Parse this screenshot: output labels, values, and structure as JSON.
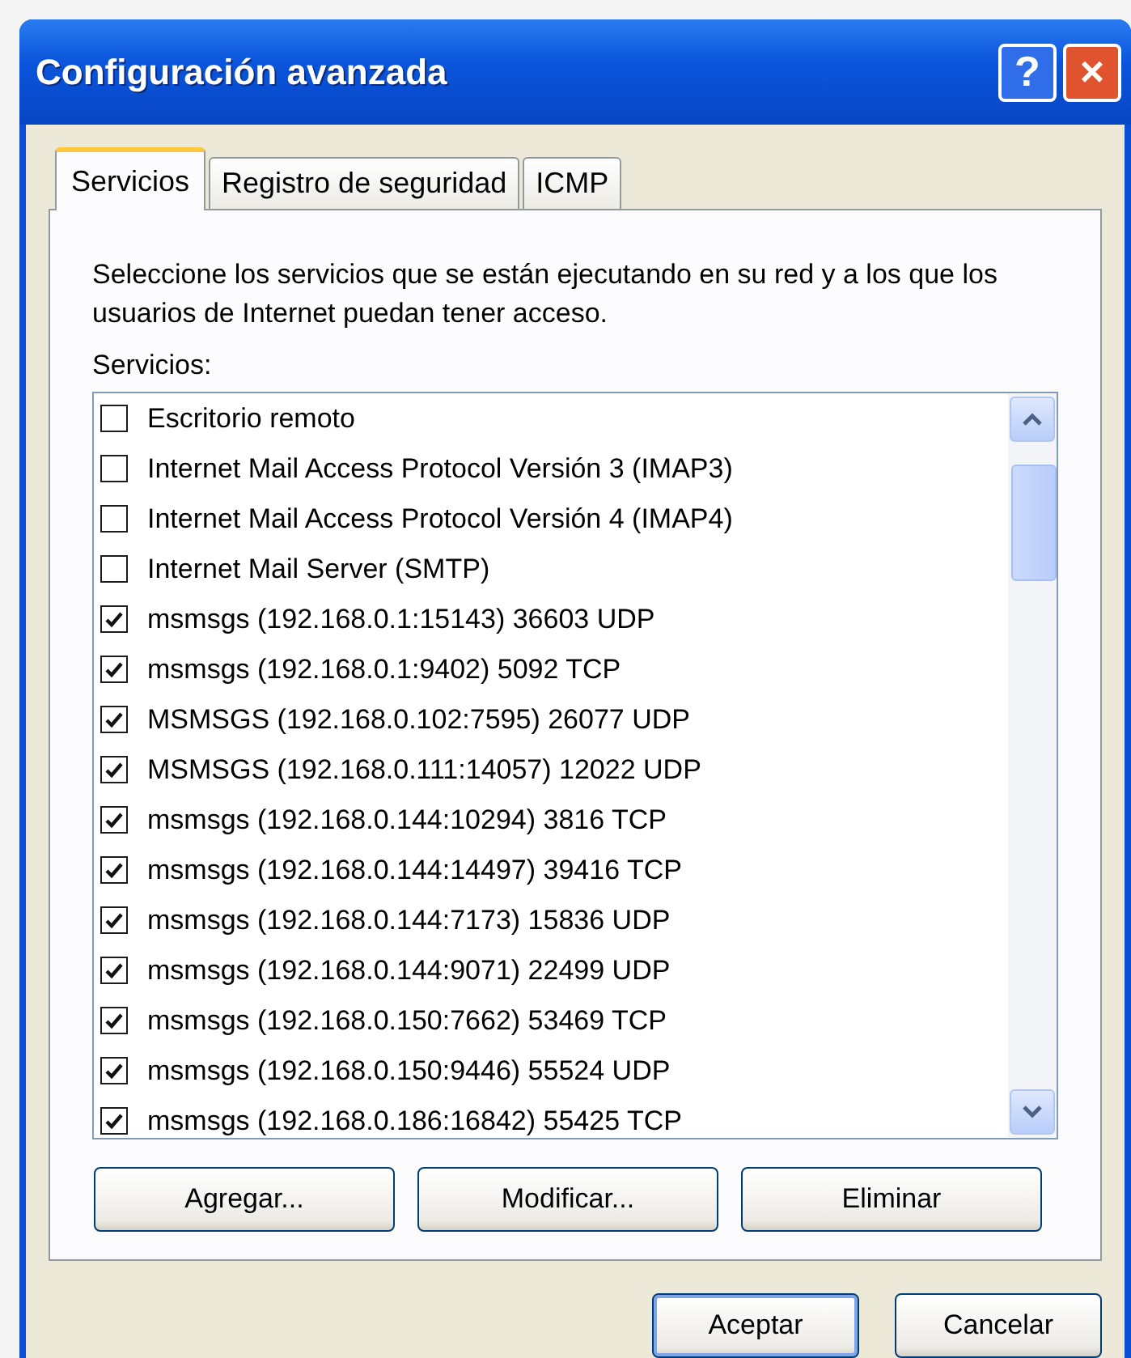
{
  "window": {
    "title": "Configuración avanzada",
    "title_buttons": [
      "?",
      "×"
    ]
  },
  "tabs": [
    {
      "label": "Servicios",
      "selected": true
    },
    {
      "label": "Registro de seguridad",
      "selected": false
    },
    {
      "label": "ICMP",
      "selected": false
    }
  ],
  "description": "Seleccione los servicios que se están ejecutando en su red y a los que los usuarios de Internet puedan tener acceso.",
  "services_label": "Servicios:",
  "services": [
    {
      "label": "Escritorio remoto",
      "checked": false
    },
    {
      "label": "Internet Mail Access Protocol Versión 3 (IMAP3)",
      "checked": false
    },
    {
      "label": "Internet Mail Access Protocol Versión 4 (IMAP4)",
      "checked": false
    },
    {
      "label": "Internet Mail Server (SMTP)",
      "checked": false
    },
    {
      "label": "msmsgs (192.168.0.1:15143) 36603 UDP",
      "checked": true
    },
    {
      "label": "msmsgs (192.168.0.1:9402) 5092 TCP",
      "checked": true
    },
    {
      "label": "MSMSGS (192.168.0.102:7595) 26077 UDP",
      "checked": true
    },
    {
      "label": "MSMSGS (192.168.0.111:14057) 12022 UDP",
      "checked": true
    },
    {
      "label": "msmsgs (192.168.0.144:10294) 3816 TCP",
      "checked": true
    },
    {
      "label": "msmsgs (192.168.0.144:14497) 39416 TCP",
      "checked": true
    },
    {
      "label": "msmsgs (192.168.0.144:7173) 15836 UDP",
      "checked": true
    },
    {
      "label": "msmsgs (192.168.0.144:9071) 22499 UDP",
      "checked": true
    },
    {
      "label": "msmsgs (192.168.0.150:7662) 53469 TCP",
      "checked": true
    },
    {
      "label": "msmsgs (192.168.0.150:9446) 55524 UDP",
      "checked": true
    },
    {
      "label": "msmsgs (192.168.0.186:16842) 55425 TCP",
      "checked": true
    }
  ],
  "list_buttons": [
    "Agregar...",
    "Modificar...",
    "Eliminar"
  ],
  "dialog_buttons": [
    {
      "label": "Aceptar",
      "default": true
    },
    {
      "label": "Cancelar",
      "default": false
    }
  ]
}
